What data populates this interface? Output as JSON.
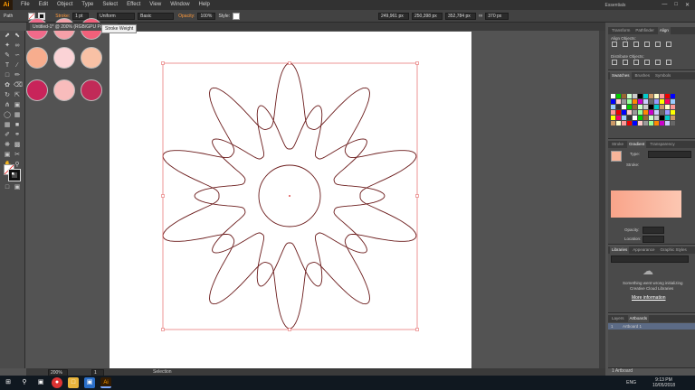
{
  "app": {
    "logo": "Ai",
    "workspace": "Essentials"
  },
  "menu": [
    "File",
    "Edit",
    "Object",
    "Type",
    "Select",
    "Effect",
    "View",
    "Window",
    "Help"
  ],
  "control": {
    "label": "Path",
    "stroke_label": "Stroke:",
    "stroke_value": "1 pt",
    "profile": "Uniform",
    "brush": "Basic",
    "opacity_label": "Opacity:",
    "opacity_value": "100%",
    "style_label": "Style:",
    "x": "249,961 px",
    "y": "250,398 px",
    "w": "352,784 px",
    "h": "370 px"
  },
  "document": {
    "tab_title": "Untitled-1* @ 200% (RGB/GPU Preview)"
  },
  "tooltip": "Stroke Weight",
  "big_swatches": [
    "#f06a8a",
    "#f5a0a8",
    "#f2607a",
    "#f7ad8e",
    "#fbd3d6",
    "#f9c1a5",
    "#c8245a",
    "#f8bcbc",
    "#c12a58"
  ],
  "panels": {
    "transform_tabs": [
      "Transform",
      "Pathfinder",
      "Align"
    ],
    "align_objects": "Align Objects:",
    "distribute_objects": "Distribute Objects:",
    "swatch_tabs": [
      "Swatches",
      "Brushes",
      "Symbols"
    ],
    "gradient_tabs": [
      "Stroke",
      "Gradient",
      "Transparency"
    ],
    "type_label": "Type:",
    "stroke_label": "Stroke:",
    "opacity_label": "Opacity:",
    "location_label": "Location:",
    "libraries_tabs": [
      "Libraries",
      "Appearance",
      "Graphic Styles"
    ],
    "libraries_msg_1": "Something went wrong initializing",
    "libraries_msg_2": "Creative Cloud Libraries",
    "more_info": "More information",
    "layers_tabs": [
      "Layers",
      "Artboards"
    ],
    "artboard_num": "1",
    "artboard_name": "Artboard 1"
  },
  "status": {
    "zoom": "200%",
    "page": "1",
    "tool": "Selection",
    "artboards_count": "1 Artboard"
  },
  "taskbar": {
    "time": "9:13 PM",
    "date": "10/05/2018",
    "lang": "ENG"
  },
  "colors": {
    "fill_swatch": "#f7b59a",
    "gradient_start": "#f9a48a",
    "gradient_end": "#fcc7b2",
    "selection": "#e05050",
    "path": "#6b1b1b"
  }
}
